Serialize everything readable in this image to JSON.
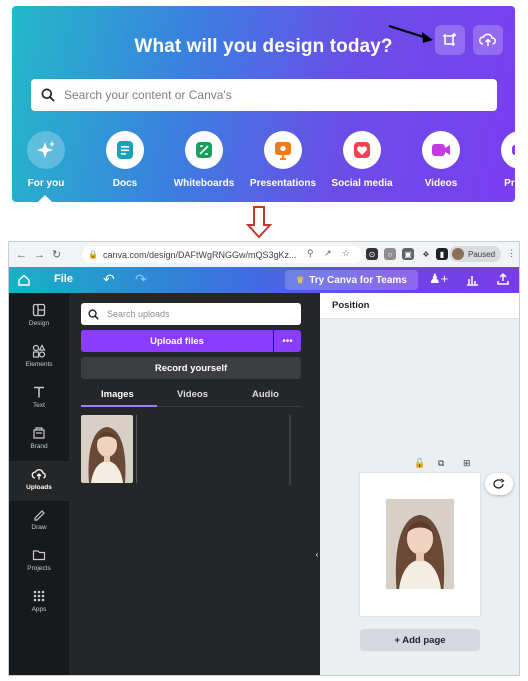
{
  "hero": {
    "title": "What will you design today?",
    "search_placeholder": "Search your content or Canva's",
    "categories": [
      {
        "label": "For you",
        "icon": "sparkle-icon",
        "color": "#2c6ae0"
      },
      {
        "label": "Docs",
        "icon": "doc-icon",
        "color": "#14a3b8"
      },
      {
        "label": "Whiteboards",
        "icon": "whiteboard-icon",
        "color": "#1a9e5b"
      },
      {
        "label": "Presentations",
        "icon": "presentation-icon",
        "color": "#f27a1a"
      },
      {
        "label": "Social media",
        "icon": "heart-icon",
        "color": "#f0424f"
      },
      {
        "label": "Videos",
        "icon": "video-icon",
        "color": "#c43ce0"
      },
      {
        "label": "Print p",
        "icon": "print-icon",
        "color": "#8b3dff"
      }
    ]
  },
  "browser": {
    "url": "canva.com/design/DAFtWgRNGGw/mQS3gKz...",
    "profile_status": "Paused"
  },
  "editor": {
    "menu_file": "File",
    "try_teams": "Try Canva for Teams",
    "rail": [
      {
        "label": "Design",
        "icon": "design-icon"
      },
      {
        "label": "Elements",
        "icon": "elements-icon"
      },
      {
        "label": "Text",
        "icon": "text-icon"
      },
      {
        "label": "Brand",
        "icon": "brand-icon"
      },
      {
        "label": "Uploads",
        "icon": "uploads-icon"
      },
      {
        "label": "Draw",
        "icon": "draw-icon"
      },
      {
        "label": "Projects",
        "icon": "folder-icon"
      },
      {
        "label": "Apps",
        "icon": "apps-icon"
      }
    ],
    "search_placeholder": "Search uploads",
    "upload_files": "Upload files",
    "more": "•••",
    "record_yourself": "Record yourself",
    "tabs": [
      "Images",
      "Videos",
      "Audio"
    ],
    "active_tab": "Images",
    "position_label": "Position",
    "add_page": "+ Add page"
  }
}
